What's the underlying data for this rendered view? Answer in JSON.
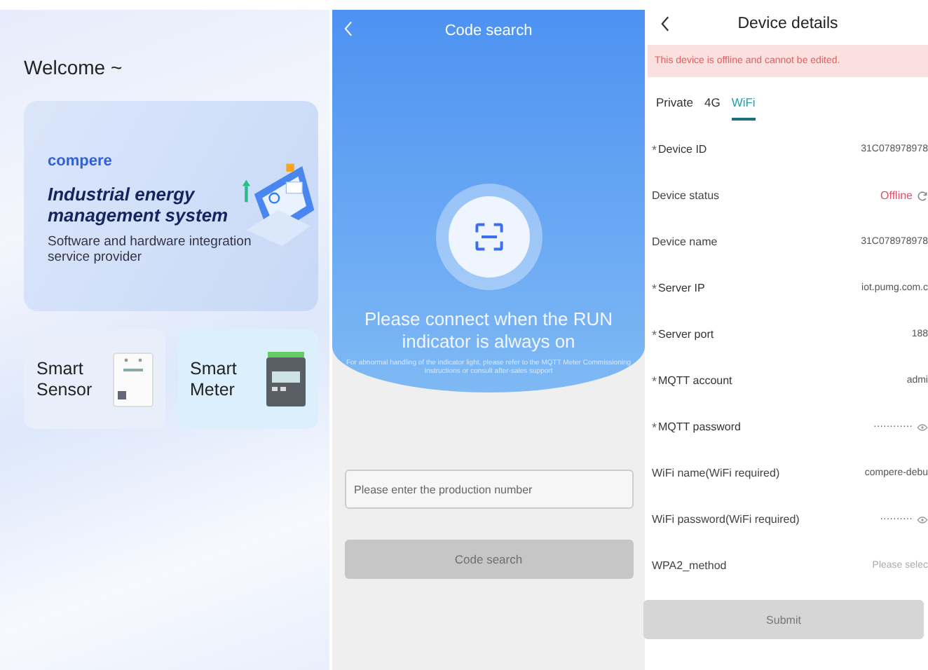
{
  "welcome": {
    "greeting": "Welcome ~",
    "banner": {
      "brand": "compere",
      "title": "Industrial energy management system",
      "subtitle": "Software and hardware integration service provider"
    },
    "products": [
      {
        "name": "Smart Sensor",
        "kind": "sensor"
      },
      {
        "name": "Smart Meter",
        "kind": "meter"
      }
    ]
  },
  "code_search": {
    "title": "Code search",
    "headline": "Please connect when the RUN indicator is always on",
    "note": "For abnormal handling of the indicator light, please refer to the MQTT Meter Commissioning Instructions or consult after-sales support",
    "input": {
      "placeholder": "Please enter the production number"
    },
    "button": {
      "label": "Code search",
      "disabled": true
    }
  },
  "device_details": {
    "title": "Device details",
    "required_mark": "*",
    "alert": "This device is offline and cannot be edited.",
    "tabs": [
      {
        "label": "Private",
        "selected": false
      },
      {
        "label": "4G",
        "selected": false
      },
      {
        "label": "WiFi",
        "selected": true
      }
    ],
    "fields": [
      {
        "label": "Device ID",
        "value": "31C078978978",
        "required": true,
        "kind": "text"
      },
      {
        "label": "Device status",
        "value": "Offline",
        "required": false,
        "kind": "status"
      },
      {
        "label": "Device name",
        "value": "31C078978978",
        "required": false,
        "kind": "text"
      },
      {
        "label": "Server IP",
        "value": "iot.pumg.com.c",
        "required": true,
        "kind": "text"
      },
      {
        "label": "Server port",
        "value": "188",
        "required": true,
        "kind": "text"
      },
      {
        "label": "MQTT account",
        "value": "admi",
        "required": true,
        "kind": "text"
      },
      {
        "label": "MQTT password",
        "value": "············",
        "required": true,
        "kind": "password"
      },
      {
        "label": "WiFi name(WiFi required)",
        "value": "compere-debu",
        "required": false,
        "kind": "text"
      },
      {
        "label": "WiFi password(WiFi required)",
        "value": "··········",
        "required": false,
        "kind": "password"
      },
      {
        "label": "WPA2_method",
        "placeholder": "Please selec",
        "required": false,
        "kind": "select"
      }
    ],
    "submit": {
      "label": "Submit",
      "disabled": true
    }
  }
}
